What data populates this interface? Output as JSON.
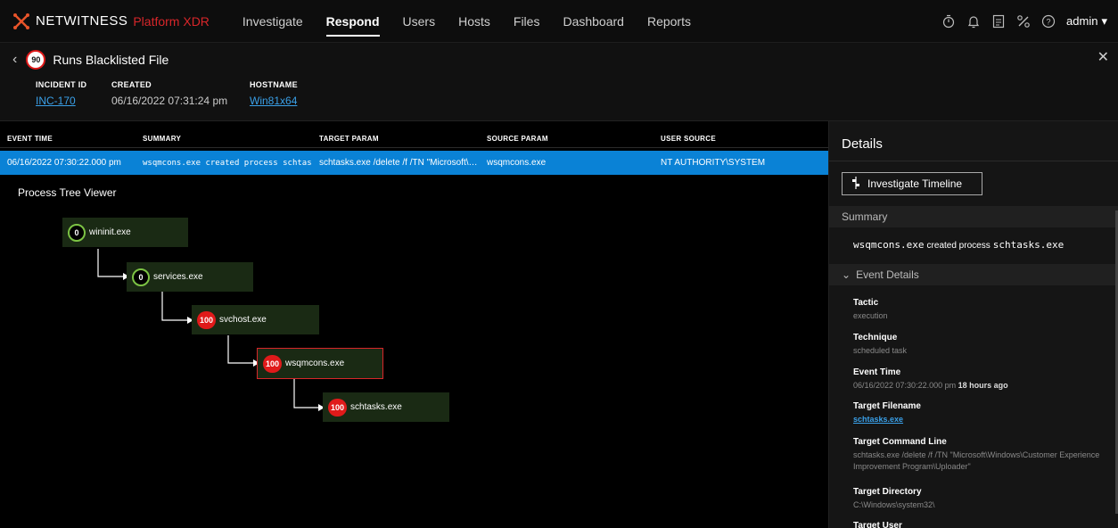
{
  "nav": {
    "brand": "NETWITNESS",
    "brand_sub": "Platform XDR",
    "items": [
      "Investigate",
      "Respond",
      "Users",
      "Hosts",
      "Files",
      "Dashboard",
      "Reports"
    ],
    "active": "Respond",
    "user": "admin",
    "icons": [
      "stopwatch-icon",
      "bell-icon",
      "notes-icon",
      "tools-icon",
      "help-icon"
    ]
  },
  "incident": {
    "score": "90",
    "title": "Runs Blacklisted File",
    "id_label": "INCIDENT ID",
    "id": "INC-170",
    "created_label": "CREATED",
    "created": "06/16/2022 07:31:24 pm",
    "hostname_label": "HOSTNAME",
    "hostname": "Win81x64"
  },
  "table": {
    "headers": [
      "EVENT TIME",
      "SUMMARY",
      "TARGET PARAM",
      "SOURCE PARAM",
      "USER SOURCE"
    ],
    "row": {
      "time": "06/16/2022 07:30:22.000 pm",
      "summary": "wsqmcons.exe created process schtas…",
      "target": "schtasks.exe /delete /f /TN \"Microsoft\\…",
      "source": "wsqmcons.exe",
      "user": "NT AUTHORITY\\SYSTEM"
    }
  },
  "tree": {
    "title": "Process Tree Viewer",
    "nodes": [
      {
        "score": "0",
        "name": "wininit.exe"
      },
      {
        "score": "0",
        "name": "services.exe"
      },
      {
        "score": "100",
        "name": "svchost.exe"
      },
      {
        "score": "100",
        "name": "wsqmcons.exe"
      },
      {
        "score": "100",
        "name": "schtasks.exe"
      }
    ]
  },
  "details": {
    "title": "Details",
    "button": "Investigate Timeline",
    "summary_label": "Summary",
    "summary_proc1": "wsqmcons.exe",
    "summary_mid": "created process",
    "summary_proc2": "schtasks.exe",
    "event_details_label": "Event Details",
    "tactic_label": "Tactic",
    "tactic": "execution",
    "technique_label": "Technique",
    "technique": "scheduled task",
    "event_time_label": "Event Time",
    "event_time": "06/16/2022 07:30:22.000 pm",
    "event_time_ago": "18 hours ago",
    "target_filename_label": "Target Filename",
    "target_filename": "schtasks.exe",
    "target_cmd_label": "Target Command Line",
    "target_cmd": "schtasks.exe /delete /f /TN \"Microsoft\\Windows\\Customer Experience Improvement Program\\Uploader\"",
    "target_dir_label": "Target Directory",
    "target_dir": "C:\\Windows\\system32\\",
    "target_user_label": "Target User"
  }
}
